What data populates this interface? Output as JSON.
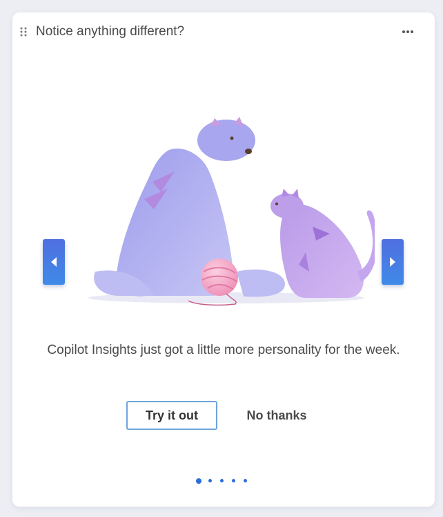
{
  "card": {
    "title": "Notice anything different?",
    "message": "Copilot Insights just got a little more personality for the week.",
    "primary_button": "Try it out",
    "secondary_button": "No thanks"
  },
  "carousel": {
    "slide_count": 5,
    "active_index": 0
  },
  "colors": {
    "accent": "#2b6fd6",
    "button_border": "#6ea4db",
    "bear": "#a9a9ef",
    "cat": "#c5a4ec",
    "yarn": "#f3a3c4"
  },
  "icons": [
    "drag-handle-icon",
    "more-options-icon",
    "chevron-left-icon",
    "chevron-right-icon"
  ]
}
